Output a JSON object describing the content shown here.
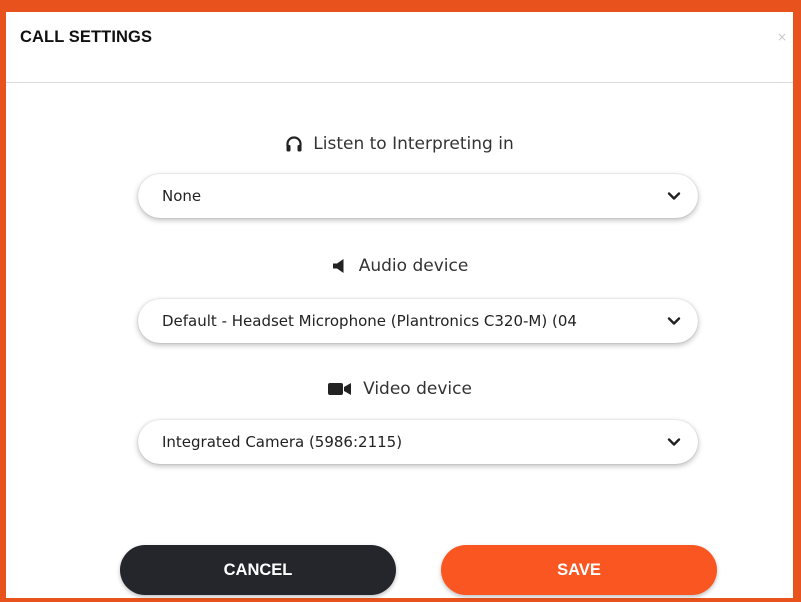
{
  "dialog": {
    "title": "CALL SETTINGS",
    "close": "×"
  },
  "interpreting": {
    "label": "Listen to Interpreting in",
    "icon": "headphones-icon",
    "value": "None"
  },
  "audio": {
    "label": "Audio device",
    "icon": "speaker-icon",
    "value": "Default - Headset Microphone (Plantronics C320-M) (04"
  },
  "video": {
    "label": "Video device",
    "icon": "video-camera-icon",
    "value": "Integrated Camera (5986:2115)"
  },
  "buttons": {
    "cancel_label": "CANCEL",
    "save_label": "SAVE"
  },
  "colors": {
    "accent": "#e8531d",
    "save": "#fa5622",
    "cancel": "#24262b"
  }
}
